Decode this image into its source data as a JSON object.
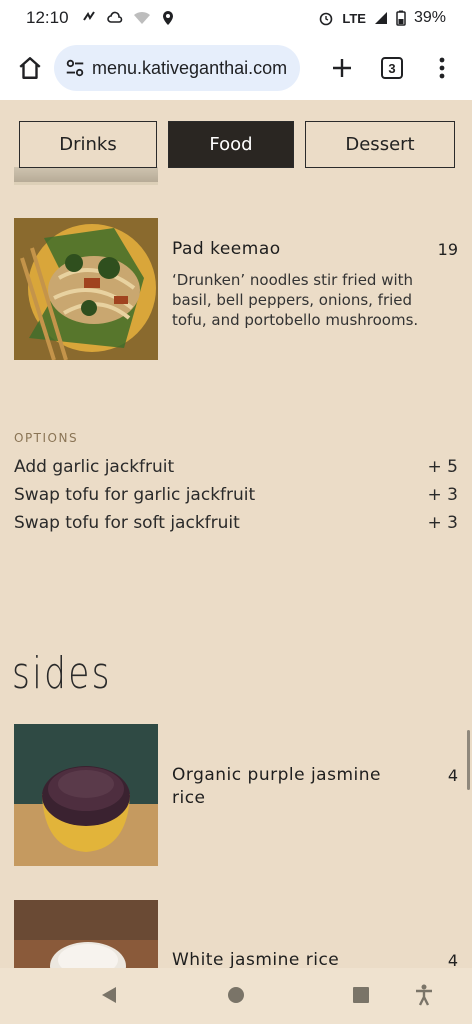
{
  "status": {
    "time": "12:10",
    "network": "LTE",
    "battery": "39%"
  },
  "browser": {
    "url": "menu.kativeganthai.com",
    "tab_count": "3"
  },
  "categories": [
    {
      "label": "Drinks",
      "active": false
    },
    {
      "label": "Food",
      "active": true
    },
    {
      "label": "Dessert",
      "active": false
    }
  ],
  "items": [
    {
      "name": "Pad keemao",
      "price": "19",
      "description": "‘Drunken’ noodles stir fried with basil, bell peppers, onions, fried tofu, and portobello mushrooms."
    }
  ],
  "options": {
    "label": "OPTIONS",
    "rows": [
      {
        "label": "Add garlic jackfruit",
        "price": "+ 5"
      },
      {
        "label": "Swap tofu for garlic jackfruit",
        "price": "+ 3"
      },
      {
        "label": "Swap tofu for soft jackfruit",
        "price": "+ 3"
      }
    ]
  },
  "sides": {
    "title": "sides",
    "items": [
      {
        "name": "Organic purple jasmine rice",
        "price": "4"
      },
      {
        "name": "White jasmine rice",
        "price": "4"
      }
    ]
  }
}
